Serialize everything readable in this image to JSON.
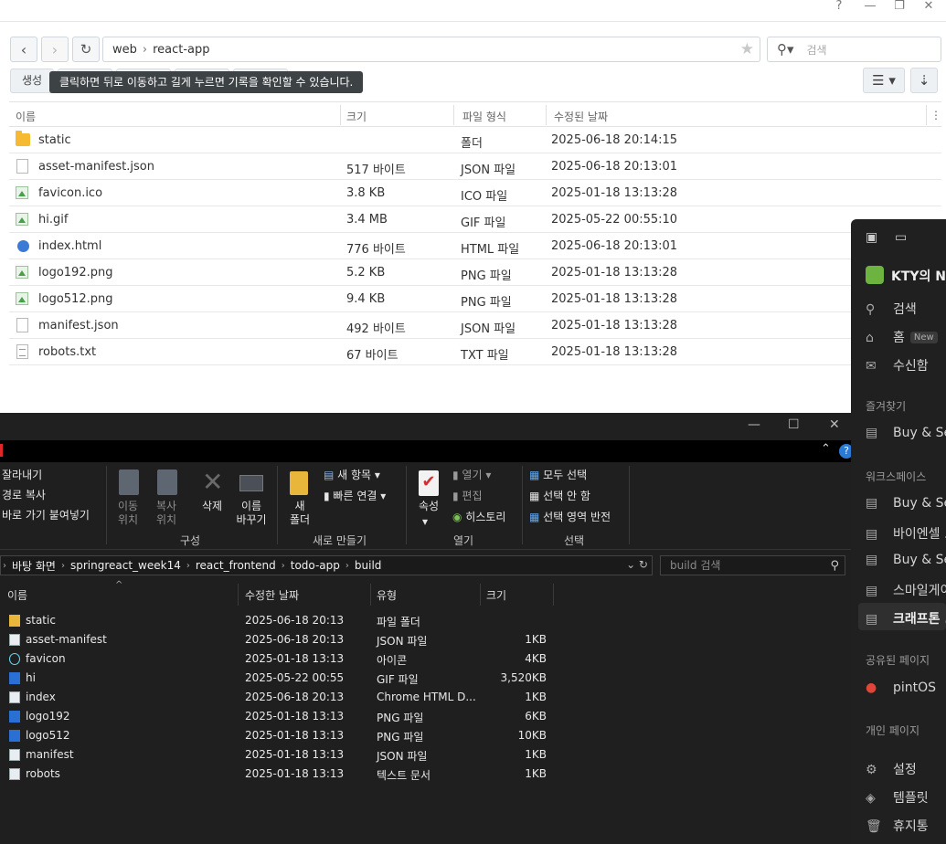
{
  "browser": {
    "window_buttons": [
      "?",
      "—",
      "❐",
      "✕"
    ],
    "address": {
      "segments": [
        "web",
        "react-app"
      ]
    },
    "search_placeholder": "검색",
    "toolbar": {
      "create_label": "생성"
    },
    "tooltip": "클릭하면 뒤로 이동하고 길게 누르면 기록을 확인할 수 있습니다.",
    "columns": [
      "이름",
      "크기",
      "파일 형식",
      "수정된 날짜"
    ],
    "rows": [
      {
        "icon": "folder-icon",
        "name": "static",
        "size": "",
        "type": "폴더",
        "date": "2025-06-18 20:14:15"
      },
      {
        "icon": "file-icon",
        "name": "asset-manifest.json",
        "size": "517 바이트",
        "type": "JSON 파일",
        "date": "2025-06-18 20:13:01"
      },
      {
        "icon": "image-icon",
        "name": "favicon.ico",
        "size": "3.8 KB",
        "type": "ICO 파일",
        "date": "2025-01-18 13:13:28"
      },
      {
        "icon": "image-icon",
        "name": "hi.gif",
        "size": "3.4 MB",
        "type": "GIF 파일",
        "date": "2025-05-22 00:55:10"
      },
      {
        "icon": "html-icon",
        "name": "index.html",
        "size": "776 바이트",
        "type": "HTML 파일",
        "date": "2025-06-18 20:13:01"
      },
      {
        "icon": "image-icon",
        "name": "logo192.png",
        "size": "5.2 KB",
        "type": "PNG 파일",
        "date": "2025-01-18 13:13:28"
      },
      {
        "icon": "image-icon",
        "name": "logo512.png",
        "size": "9.4 KB",
        "type": "PNG 파일",
        "date": "2025-01-18 13:13:28"
      },
      {
        "icon": "file-icon",
        "name": "manifest.json",
        "size": "492 바이트",
        "type": "JSON 파일",
        "date": "2025-01-18 13:13:28"
      },
      {
        "icon": "text-file-icon",
        "name": "robots.txt",
        "size": "67 바이트",
        "type": "TXT 파일",
        "date": "2025-01-18 13:13:28"
      }
    ]
  },
  "explorer": {
    "window_buttons": [
      "—",
      "☐",
      "✕"
    ],
    "ribbon": {
      "clipboard": {
        "cut": "잘라내기",
        "copy_path": "경로 복사",
        "paste_shortcut": "바로 가기 붙여넣기"
      },
      "organize": {
        "move_to": "이동\n위치",
        "copy_to": "복사\n위치",
        "delete": "삭제",
        "rename": "이름\n바꾸기",
        "group": "구성"
      },
      "new": {
        "new_folder": "새\n폴더",
        "new_item": "새 항목",
        "easy_access": "빠른 연결",
        "group": "새로 만들기"
      },
      "open": {
        "properties": "속성",
        "open": "열기",
        "edit": "편집",
        "history": "히스토리",
        "group": "열기"
      },
      "select": {
        "select_all": "모두 선택",
        "select_none": "선택 안 함",
        "invert": "선택 영역 반전",
        "group": "선택"
      }
    },
    "path": [
      "바탕 화면",
      "springreact_week14",
      "react_frontend",
      "todo-app",
      "build"
    ],
    "search_placeholder": "build 검색",
    "columns": [
      "이름",
      "수정한 날짜",
      "유형",
      "크기"
    ],
    "rows": [
      {
        "icon": "folder-icon",
        "name": "static",
        "date": "2025-06-18 20:13",
        "type": "파일 폴더",
        "size": ""
      },
      {
        "icon": "json-icon",
        "name": "asset-manifest",
        "date": "2025-06-18 20:13",
        "type": "JSON 파일",
        "size": "1KB"
      },
      {
        "icon": "react-icon",
        "name": "favicon",
        "date": "2025-01-18 13:13",
        "type": "아이콘",
        "size": "4KB"
      },
      {
        "icon": "image-icon",
        "name": "hi",
        "date": "2025-05-22 00:55",
        "type": "GIF 파일",
        "size": "3,520KB"
      },
      {
        "icon": "chrome-icon",
        "name": "index",
        "date": "2025-06-18 20:13",
        "type": "Chrome HTML D...",
        "size": "1KB"
      },
      {
        "icon": "image-icon",
        "name": "logo192",
        "date": "2025-01-18 13:13",
        "type": "PNG 파일",
        "size": "6KB"
      },
      {
        "icon": "image-icon",
        "name": "logo512",
        "date": "2025-01-18 13:13",
        "type": "PNG 파일",
        "size": "10KB"
      },
      {
        "icon": "json-icon",
        "name": "manifest",
        "date": "2025-01-18 13:13",
        "type": "JSON 파일",
        "size": "1KB"
      },
      {
        "icon": "text-file-icon",
        "name": "robots",
        "date": "2025-01-18 13:13",
        "type": "텍스트 문서",
        "size": "1KB"
      }
    ]
  },
  "notion": {
    "workspace_name": "KTY의 No",
    "search": "검색",
    "home": "홈",
    "home_badge": "New",
    "inbox": "수신함",
    "favorites_label": "즐겨찾기",
    "favorites": [
      "Buy & Sel"
    ],
    "workspace_label": "워크스페이스",
    "workspace_pages": [
      "Buy & Sel",
      "바이엔셀 ...",
      "Buy & Sel",
      "스마일게이",
      "크래프톤 ..."
    ],
    "shared_label": "공유된 페이지",
    "shared": [
      "pintOS"
    ],
    "private_label": "개인 페이지",
    "settings": "설정",
    "templates": "템플릿",
    "trash": "휴지통"
  }
}
